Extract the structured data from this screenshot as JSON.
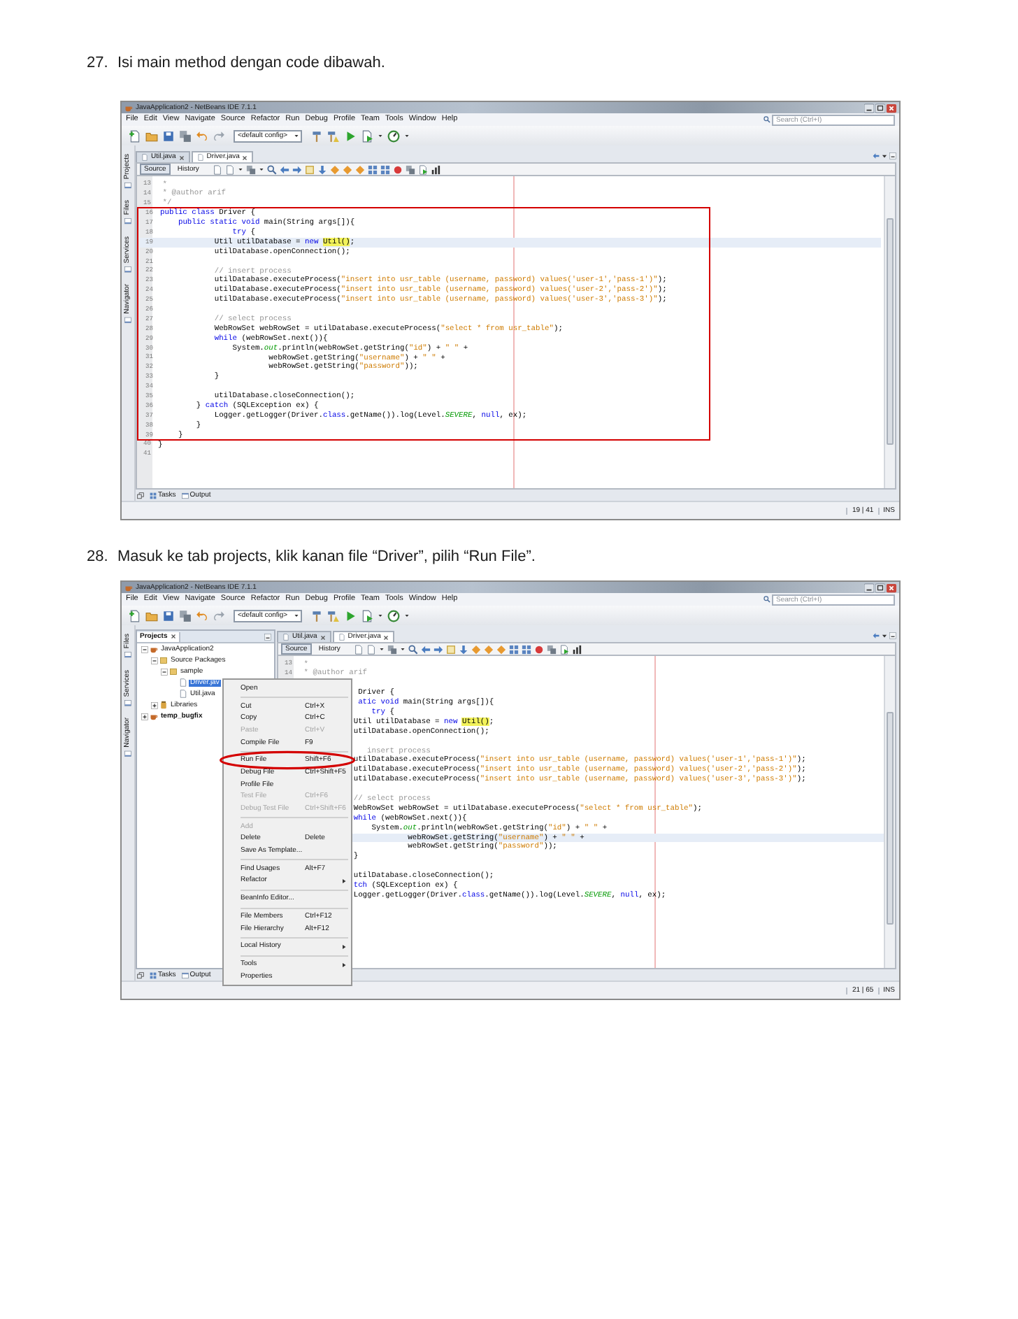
{
  "steps": [
    {
      "number": "27.",
      "text": "Isi main method dengan code dibawah.",
      "screenshot": {
        "title": "JavaApplication2 - NetBeans IDE 7.1.1",
        "menu": [
          "File",
          "Edit",
          "View",
          "Navigate",
          "Source",
          "Refactor",
          "Run",
          "Debug",
          "Profile",
          "Team",
          "Tools",
          "Window",
          "Help"
        ],
        "search": {
          "placeholder": "Search (Ctrl+I)"
        },
        "config": "<default config>",
        "side_tabs": [
          "Projects",
          "Files",
          "Services",
          "Navigator"
        ],
        "editor_tabs": [
          {
            "label": "Util.java",
            "selected": false
          },
          {
            "label": "Driver.java",
            "selected": true
          }
        ],
        "view_buttons": [
          {
            "label": "Source",
            "selected": true
          },
          {
            "label": "History",
            "selected": false
          }
        ],
        "lines": [
          {
            "number": "13",
            "kind": "code",
            "current": false,
            "boxed": false,
            "tokens": [
              {
                "text": " *",
                "kind": "comment"
              }
            ]
          },
          {
            "number": "14",
            "kind": "code",
            "current": false,
            "boxed": false,
            "tokens": [
              {
                "text": " * @author arif",
                "kind": "comment"
              }
            ]
          },
          {
            "number": "15",
            "kind": "code",
            "current": false,
            "boxed": false,
            "tokens": [
              {
                "text": " */",
                "kind": "comment"
              }
            ]
          },
          {
            "number": "16",
            "kind": "code",
            "current": false,
            "boxed": true,
            "tokens": [
              {
                "text": "public class",
                "kind": "keyword"
              },
              {
                "text": " Driver {",
                "kind": "plain"
              }
            ]
          },
          {
            "number": "17",
            "kind": "code",
            "current": false,
            "boxed": true,
            "tokens": [
              {
                "text": "    public static void",
                "kind": "keyword"
              },
              {
                "text": " main(String args[]){",
                "kind": "plain"
              }
            ]
          },
          {
            "number": "18",
            "kind": "code",
            "current": false,
            "boxed": true,
            "tokens": [
              {
                "text": "                try",
                "kind": "keyword"
              },
              {
                "text": " {",
                "kind": "plain"
              }
            ]
          },
          {
            "number": "19",
            "kind": "code",
            "current": true,
            "boxed": true,
            "tokens": [
              {
                "text": "            Util utilDatabase = ",
                "kind": "plain"
              },
              {
                "text": "new ",
                "kind": "keyword"
              },
              {
                "text": "Util()",
                "kind": "mark"
              },
              {
                "text": ";",
                "kind": "plain"
              }
            ]
          },
          {
            "number": "20",
            "kind": "code",
            "current": false,
            "boxed": true,
            "tokens": [
              {
                "text": "            utilDatabase.openConnection();",
                "kind": "plain"
              }
            ]
          },
          {
            "number": "21",
            "kind": "code",
            "current": false,
            "boxed": true
          },
          {
            "number": "22",
            "kind": "code",
            "current": false,
            "boxed": true,
            "tokens": [
              {
                "text": "            // insert process",
                "kind": "comment"
              }
            ]
          },
          {
            "number": "23",
            "kind": "code",
            "current": false,
            "boxed": true,
            "tokens": [
              {
                "text": "            utilDatabase.executeProcess(",
                "kind": "plain"
              },
              {
                "text": "\"insert into usr_table (username, password) values('user-1','pass-1')\"",
                "kind": "string"
              },
              {
                "text": ");",
                "kind": "plain"
              }
            ]
          },
          {
            "number": "24",
            "kind": "code",
            "current": false,
            "boxed": true,
            "tokens": [
              {
                "text": "            utilDatabase.executeProcess(",
                "kind": "plain"
              },
              {
                "text": "\"insert into usr_table (username, password) values('user-2','pass-2')\"",
                "kind": "string"
              },
              {
                "text": ");",
                "kind": "plain"
              }
            ]
          },
          {
            "number": "25",
            "kind": "code",
            "current": false,
            "boxed": true,
            "tokens": [
              {
                "text": "            utilDatabase.executeProcess(",
                "kind": "plain"
              },
              {
                "text": "\"insert into usr_table (username, password) values('user-3','pass-3')\"",
                "kind": "string"
              },
              {
                "text": ");",
                "kind": "plain"
              }
            ]
          },
          {
            "number": "26",
            "kind": "code",
            "current": false,
            "boxed": true
          },
          {
            "number": "27",
            "kind": "code",
            "current": false,
            "boxed": true,
            "tokens": [
              {
                "text": "            // select process",
                "kind": "comment"
              }
            ]
          },
          {
            "number": "28",
            "kind": "code",
            "current": false,
            "boxed": true,
            "tokens": [
              {
                "text": "            WebRowSet webRowSet = utilDatabase.executeProcess(",
                "kind": "plain"
              },
              {
                "text": "\"select * from usr_table\"",
                "kind": "string"
              },
              {
                "text": ");",
                "kind": "plain"
              }
            ]
          },
          {
            "number": "29",
            "kind": "code",
            "current": false,
            "boxed": true,
            "tokens": [
              {
                "text": "            while",
                "kind": "keyword"
              },
              {
                "text": " (webRowSet.next()){",
                "kind": "plain"
              }
            ]
          },
          {
            "number": "30",
            "kind": "code",
            "current": false,
            "boxed": true,
            "tokens": [
              {
                "text": "                System.",
                "kind": "plain"
              },
              {
                "text": "out",
                "kind": "static"
              },
              {
                "text": ".println(webRowSet.getString(",
                "kind": "plain"
              },
              {
                "text": "\"id\"",
                "kind": "string"
              },
              {
                "text": ") + ",
                "kind": "plain"
              },
              {
                "text": "\" \"",
                "kind": "string"
              },
              {
                "text": " +",
                "kind": "plain"
              }
            ]
          },
          {
            "number": "31",
            "kind": "code",
            "current": false,
            "boxed": true,
            "tokens": [
              {
                "text": "                        webRowSet.getString(",
                "kind": "plain"
              },
              {
                "text": "\"username\"",
                "kind": "string"
              },
              {
                "text": ") + ",
                "kind": "plain"
              },
              {
                "text": "\" \"",
                "kind": "string"
              },
              {
                "text": " +",
                "kind": "plain"
              }
            ]
          },
          {
            "number": "32",
            "kind": "code",
            "current": false,
            "boxed": true,
            "tokens": [
              {
                "text": "                        webRowSet.getString(",
                "kind": "plain"
              },
              {
                "text": "\"password\"",
                "kind": "string"
              },
              {
                "text": "));",
                "kind": "plain"
              }
            ]
          },
          {
            "number": "33",
            "kind": "code",
            "current": false,
            "boxed": true,
            "tokens": [
              {
                "text": "            }",
                "kind": "plain"
              }
            ]
          },
          {
            "number": "34",
            "kind": "code",
            "current": false,
            "boxed": true
          },
          {
            "number": "35",
            "kind": "code",
            "current": false,
            "boxed": true,
            "tokens": [
              {
                "text": "            utilDatabase.closeConnection();",
                "kind": "plain"
              }
            ]
          },
          {
            "number": "36",
            "kind": "code",
            "current": false,
            "boxed": true,
            "tokens": [
              {
                "text": "        } ",
                "kind": "plain"
              },
              {
                "text": "catch",
                "kind": "keyword"
              },
              {
                "text": " (SQLException ex) {",
                "kind": "plain"
              }
            ]
          },
          {
            "number": "37",
            "kind": "code",
            "current": false,
            "boxed": true,
            "tokens": [
              {
                "text": "            Logger.getLogger(Driver.",
                "kind": "plain"
              },
              {
                "text": "class",
                "kind": "keyword"
              },
              {
                "text": ".getName()).log(Level.",
                "kind": "plain"
              },
              {
                "text": "SEVERE",
                "kind": "static"
              },
              {
                "text": ", ",
                "kind": "plain"
              },
              {
                "text": "null",
                "kind": "keyword"
              },
              {
                "text": ", ex);",
                "kind": "plain"
              }
            ]
          },
          {
            "number": "38",
            "kind": "code",
            "current": false,
            "boxed": true,
            "tokens": [
              {
                "text": "        }",
                "kind": "plain"
              }
            ]
          },
          {
            "number": "39",
            "kind": "code",
            "current": false,
            "boxed": true,
            "tokens": [
              {
                "text": "    }",
                "kind": "plain"
              }
            ]
          },
          {
            "number": "40",
            "kind": "code",
            "current": false,
            "boxed": false,
            "tokens": [
              {
                "text": "}",
                "kind": "plain"
              }
            ]
          },
          {
            "number": "41",
            "kind": "code",
            "current": false,
            "boxed": false
          }
        ],
        "bottom_tabs": [
          "Tasks",
          "Output"
        ],
        "status": {
          "position": "19 | 41",
          "mode": "INS"
        }
      }
    },
    {
      "number": "28.",
      "text": "Masuk ke tab projects, klik kanan file “Driver”, pilih “Run File”.",
      "screenshot": {
        "title": "JavaApplication2 - NetBeans IDE 7.1.1",
        "menu": [
          "File",
          "Edit",
          "View",
          "Navigate",
          "Source",
          "Refactor",
          "Run",
          "Debug",
          "Profile",
          "Team",
          "Tools",
          "Window",
          "Help"
        ],
        "search": {
          "placeholder": "Search (Ctrl+I)"
        },
        "config": "<default config>",
        "side_tabs": [
          "Files",
          "Services",
          "Navigator"
        ],
        "projects": {
          "tab": "Projects",
          "tree": [
            {
              "label": "JavaApplication2",
              "kind": "project",
              "expanded": true,
              "selected": false,
              "bold": false,
              "children": [
                {
                  "label": "Source Packages",
                  "kind": "packages",
                  "expanded": true,
                  "selected": false,
                  "bold": false,
                  "children": [
                    {
                      "label": "sample",
                      "kind": "package",
                      "expanded": true,
                      "selected": false,
                      "bold": false,
                      "children": [
                        {
                          "label": "Driver.jav",
                          "kind": "file",
                          "selected": true,
                          "bold": false
                        },
                        {
                          "label": "Util.java",
                          "kind": "file",
                          "selected": false,
                          "bold": false
                        }
                      ]
                    }
                  ]
                },
                {
                  "label": "Libraries",
                  "kind": "library",
                  "expanded": false,
                  "selected": false,
                  "bold": false
                }
              ]
            },
            {
              "label": "temp_bugfix",
              "kind": "project",
              "expanded": false,
              "selected": false,
              "bold": true
            }
          ]
        },
        "editor_tabs": [
          {
            "label": "Util.java",
            "selected": false
          },
          {
            "label": "Driver.java",
            "selected": true
          }
        ],
        "view_buttons": [
          {
            "label": "Source",
            "selected": true
          },
          {
            "label": "History",
            "selected": false
          }
        ],
        "lines": [
          {
            "number": "13",
            "kind": "code",
            "current": false,
            "tokens": [
              {
                "text": " *",
                "kind": "comment"
              }
            ]
          },
          {
            "number": "14",
            "kind": "code",
            "current": false,
            "tokens": [
              {
                "text": " * @author arif",
                "kind": "comment"
              }
            ]
          },
          {
            "kind": "blank",
            "current": false
          },
          {
            "kind": "code",
            "current": false,
            "tokens": [
              {
                "text": "             Driver {",
                "kind": "plain"
              }
            ]
          },
          {
            "kind": "code",
            "current": false,
            "tokens": [
              {
                "text": "             atic void",
                "kind": "keyword"
              },
              {
                "text": " main(String args[]){",
                "kind": "plain"
              }
            ]
          },
          {
            "kind": "code",
            "current": false,
            "tokens": [
              {
                "text": "                try",
                "kind": "keyword"
              },
              {
                "text": " {",
                "kind": "plain"
              }
            ]
          },
          {
            "kind": "code",
            "current": false,
            "tokens": [
              {
                "text": "            Util utilDatabase = ",
                "kind": "plain"
              },
              {
                "text": "new ",
                "kind": "keyword"
              },
              {
                "text": "Util()",
                "kind": "mark"
              },
              {
                "text": ";",
                "kind": "plain"
              }
            ]
          },
          {
            "kind": "code",
            "current": false,
            "tokens": [
              {
                "text": "            utilDatabase.openConnection();",
                "kind": "plain"
              }
            ]
          },
          {
            "kind": "blank",
            "current": false
          },
          {
            "kind": "code",
            "current": false,
            "tokens": [
              {
                "text": "               insert process",
                "kind": "comment"
              }
            ]
          },
          {
            "kind": "code",
            "current": false,
            "tokens": [
              {
                "text": "            utilDatabase.executeProcess(",
                "kind": "plain"
              },
              {
                "text": "\"insert into usr_table (username, password) values('user-1','pass-1')\"",
                "kind": "string"
              },
              {
                "text": ");",
                "kind": "plain"
              }
            ]
          },
          {
            "kind": "code",
            "current": false,
            "tokens": [
              {
                "text": "            utilDatabase.executeProcess(",
                "kind": "plain"
              },
              {
                "text": "\"insert into usr_table (username, password) values('user-2','pass-2')\"",
                "kind": "string"
              },
              {
                "text": ");",
                "kind": "plain"
              }
            ]
          },
          {
            "kind": "code",
            "current": false,
            "tokens": [
              {
                "text": "            utilDatabase.executeProcess(",
                "kind": "plain"
              },
              {
                "text": "\"insert into usr_table (username, password) values('user-3','pass-3')\"",
                "kind": "string"
              },
              {
                "text": ");",
                "kind": "plain"
              }
            ]
          },
          {
            "kind": "blank",
            "current": false
          },
          {
            "kind": "code",
            "current": false,
            "tokens": [
              {
                "text": "            // select process",
                "kind": "comment"
              }
            ]
          },
          {
            "kind": "code",
            "current": false,
            "tokens": [
              {
                "text": "            WebRowSet webRowSet = utilDatabase.executeProcess(",
                "kind": "plain"
              },
              {
                "text": "\"select * from usr_table\"",
                "kind": "string"
              },
              {
                "text": ");",
                "kind": "plain"
              }
            ]
          },
          {
            "kind": "code",
            "current": false,
            "tokens": [
              {
                "text": "            while",
                "kind": "keyword"
              },
              {
                "text": " (webRowSet.next()){",
                "kind": "plain"
              }
            ]
          },
          {
            "kind": "code",
            "current": false,
            "tokens": [
              {
                "text": "                System.",
                "kind": "plain"
              },
              {
                "text": "out",
                "kind": "static"
              },
              {
                "text": ".println(webRowSet.getString(",
                "kind": "plain"
              },
              {
                "text": "\"id\"",
                "kind": "string"
              },
              {
                "text": ") + ",
                "kind": "plain"
              },
              {
                "text": "\" \"",
                "kind": "string"
              },
              {
                "text": " +",
                "kind": "plain"
              }
            ]
          },
          {
            "kind": "code",
            "current": true,
            "tokens": [
              {
                "text": "                        webRowSet.getString(",
                "kind": "plain"
              },
              {
                "text": "\"username\"",
                "kind": "string"
              },
              {
                "text": ") + ",
                "kind": "plain"
              },
              {
                "text": "\" \"",
                "kind": "string"
              },
              {
                "text": " +",
                "kind": "plain"
              }
            ]
          },
          {
            "kind": "code",
            "current": false,
            "tokens": [
              {
                "text": "                        webRowSet.getString(",
                "kind": "plain"
              },
              {
                "text": "\"password\"",
                "kind": "string"
              },
              {
                "text": "));",
                "kind": "plain"
              }
            ]
          },
          {
            "kind": "code",
            "current": false,
            "tokens": [
              {
                "text": "            }",
                "kind": "plain"
              }
            ]
          },
          {
            "kind": "blank",
            "current": false
          },
          {
            "kind": "code",
            "current": false,
            "tokens": [
              {
                "text": "            utilDatabase.closeConnection();",
                "kind": "plain"
              }
            ]
          },
          {
            "kind": "code",
            "current": false,
            "tokens": [
              {
                "text": "            tch",
                "kind": "keyword"
              },
              {
                "text": " (SQLException ex) {",
                "kind": "plain"
              }
            ]
          },
          {
            "kind": "code",
            "current": false,
            "tokens": [
              {
                "text": "            Logger.getLogger(Driver.",
                "kind": "plain"
              },
              {
                "text": "class",
                "kind": "keyword"
              },
              {
                "text": ".getName()).log(Level.",
                "kind": "plain"
              },
              {
                "text": "SEVERE",
                "kind": "static"
              },
              {
                "text": ", ",
                "kind": "plain"
              },
              {
                "text": "null",
                "kind": "keyword"
              },
              {
                "text": ", ex);",
                "kind": "plain"
              }
            ]
          }
        ],
        "bottom_tabs": [
          "Tasks",
          "Output"
        ],
        "status": {
          "position": "21 | 65",
          "mode": "INS"
        },
        "context_menu": [
          {
            "kind": "item",
            "label": "Open",
            "disabled": false,
            "submenu": false,
            "circled": false
          },
          {
            "kind": "separator"
          },
          {
            "kind": "item",
            "label": "Cut",
            "shortcut": "Ctrl+X",
            "disabled": false,
            "submenu": false,
            "circled": false
          },
          {
            "kind": "item",
            "label": "Copy",
            "shortcut": "Ctrl+C",
            "disabled": false,
            "submenu": false,
            "circled": false
          },
          {
            "kind": "item",
            "label": "Paste",
            "shortcut": "Ctrl+V",
            "disabled": true,
            "submenu": false,
            "circled": false
          },
          {
            "kind": "item",
            "label": "Compile File",
            "shortcut": "F9",
            "disabled": false,
            "submenu": false,
            "circled": false
          },
          {
            "kind": "separator"
          },
          {
            "kind": "item",
            "label": "Run File",
            "shortcut": "Shift+F6",
            "disabled": false,
            "submenu": false,
            "circled": true
          },
          {
            "kind": "item",
            "label": "Debug File",
            "shortcut": "Ctrl+Shift+F5",
            "disabled": false,
            "submenu": false,
            "circled": false
          },
          {
            "kind": "item",
            "label": "Profile File",
            "disabled": false,
            "submenu": false,
            "circled": false
          },
          {
            "kind": "item",
            "label": "Test File",
            "shortcut": "Ctrl+F6",
            "disabled": true,
            "submenu": false,
            "circled": false
          },
          {
            "kind": "item",
            "label": "Debug Test File",
            "shortcut": "Ctrl+Shift+F6",
            "disabled": true,
            "submenu": false,
            "circled": false
          },
          {
            "kind": "separator"
          },
          {
            "kind": "item",
            "label": "Add",
            "disabled": true,
            "submenu": false,
            "circled": false
          },
          {
            "kind": "item",
            "label": "Delete",
            "shortcut": "Delete",
            "disabled": false,
            "submenu": false,
            "circled": false
          },
          {
            "kind": "item",
            "label": "Save As Template...",
            "disabled": false,
            "submenu": false,
            "circled": false
          },
          {
            "kind": "separator"
          },
          {
            "kind": "item",
            "label": "Find Usages",
            "shortcut": "Alt+F7",
            "disabled": false,
            "submenu": false,
            "circled": false
          },
          {
            "kind": "item",
            "label": "Refactor",
            "disabled": false,
            "submenu": true,
            "circled": false
          },
          {
            "kind": "separator"
          },
          {
            "kind": "item",
            "label": "BeanInfo Editor...",
            "disabled": false,
            "submenu": false,
            "circled": false
          },
          {
            "kind": "separator"
          },
          {
            "kind": "item",
            "label": "File Members",
            "shortcut": "Ctrl+F12",
            "disabled": false,
            "submenu": false,
            "circled": false
          },
          {
            "kind": "item",
            "label": "File Hierarchy",
            "shortcut": "Alt+F12",
            "disabled": false,
            "submenu": false,
            "circled": false
          },
          {
            "kind": "separator"
          },
          {
            "kind": "item",
            "label": "Local History",
            "disabled": false,
            "submenu": true,
            "circled": false
          },
          {
            "kind": "separator"
          },
          {
            "kind": "item",
            "label": "Tools",
            "disabled": false,
            "submenu": true,
            "circled": false
          },
          {
            "kind": "item",
            "label": "Properties",
            "disabled": false,
            "submenu": false,
            "circled": false
          }
        ]
      }
    }
  ]
}
